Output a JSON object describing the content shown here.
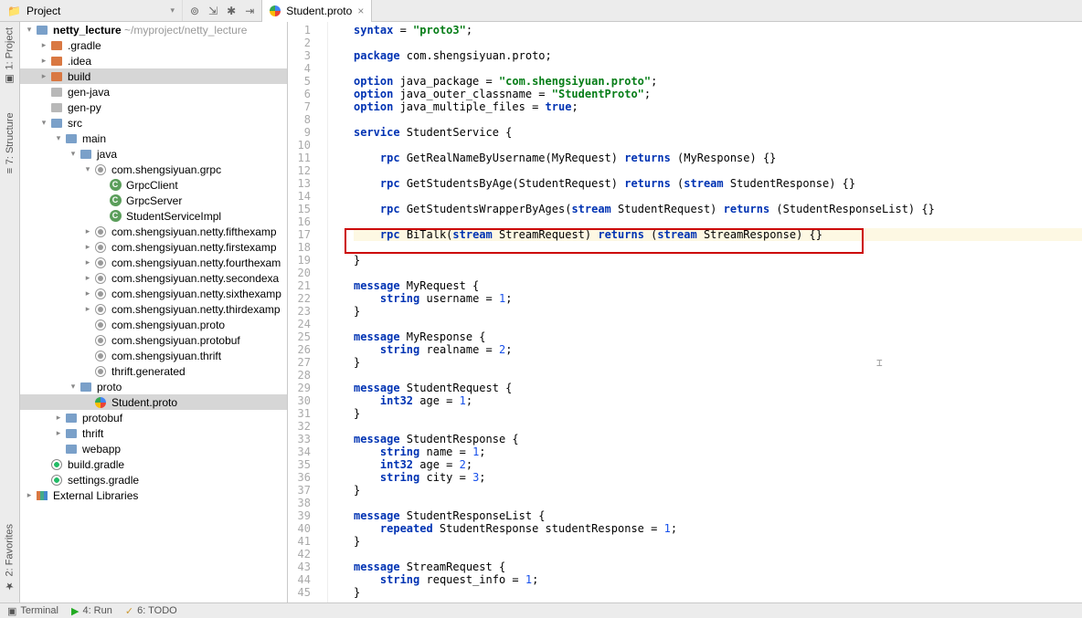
{
  "toolbar": {
    "project_label": "Project",
    "icons": [
      "target",
      "collapse",
      "settings",
      "hide"
    ]
  },
  "tab": {
    "filename": "Student.proto"
  },
  "tree": {
    "root": {
      "name": "netty_lecture",
      "path": "~/myproject/netty_lecture"
    },
    "items": [
      {
        "depth": 1,
        "arrow": "r",
        "icon": "folder-orange",
        "label": ".gradle"
      },
      {
        "depth": 1,
        "arrow": "r",
        "icon": "folder-orange",
        "label": ".idea"
      },
      {
        "depth": 1,
        "arrow": "r",
        "icon": "folder-orange",
        "label": "build",
        "sel": true
      },
      {
        "depth": 1,
        "arrow": "",
        "icon": "folder-gray",
        "label": "gen-java"
      },
      {
        "depth": 1,
        "arrow": "",
        "icon": "folder-gray",
        "label": "gen-py"
      },
      {
        "depth": 1,
        "arrow": "d",
        "icon": "folder-blue",
        "label": "src"
      },
      {
        "depth": 2,
        "arrow": "d",
        "icon": "folder-blue",
        "label": "main"
      },
      {
        "depth": 3,
        "arrow": "d",
        "icon": "folder-blue",
        "label": "java"
      },
      {
        "depth": 4,
        "arrow": "d",
        "icon": "pkg",
        "label": "com.shengsiyuan.grpc"
      },
      {
        "depth": 5,
        "arrow": "",
        "icon": "cls",
        "label": "GrpcClient"
      },
      {
        "depth": 5,
        "arrow": "",
        "icon": "cls",
        "label": "GrpcServer"
      },
      {
        "depth": 5,
        "arrow": "",
        "icon": "cls",
        "label": "StudentServiceImpl"
      },
      {
        "depth": 4,
        "arrow": "r",
        "icon": "pkg",
        "label": "com.shengsiyuan.netty.fifthexamp"
      },
      {
        "depth": 4,
        "arrow": "r",
        "icon": "pkg",
        "label": "com.shengsiyuan.netty.firstexamp"
      },
      {
        "depth": 4,
        "arrow": "r",
        "icon": "pkg",
        "label": "com.shengsiyuan.netty.fourthexam"
      },
      {
        "depth": 4,
        "arrow": "r",
        "icon": "pkg",
        "label": "com.shengsiyuan.netty.secondexa"
      },
      {
        "depth": 4,
        "arrow": "r",
        "icon": "pkg",
        "label": "com.shengsiyuan.netty.sixthexamp"
      },
      {
        "depth": 4,
        "arrow": "r",
        "icon": "pkg",
        "label": "com.shengsiyuan.netty.thirdexamp"
      },
      {
        "depth": 4,
        "arrow": "",
        "icon": "pkg",
        "label": "com.shengsiyuan.proto"
      },
      {
        "depth": 4,
        "arrow": "",
        "icon": "pkg",
        "label": "com.shengsiyuan.protobuf"
      },
      {
        "depth": 4,
        "arrow": "",
        "icon": "pkg",
        "label": "com.shengsiyuan.thrift"
      },
      {
        "depth": 4,
        "arrow": "",
        "icon": "pkg",
        "label": "thrift.generated"
      },
      {
        "depth": 3,
        "arrow": "d",
        "icon": "folder-blue",
        "label": "proto"
      },
      {
        "depth": 4,
        "arrow": "",
        "icon": "proto",
        "label": "Student.proto",
        "sel": true
      },
      {
        "depth": 2,
        "arrow": "r",
        "icon": "folder-blue",
        "label": "protobuf"
      },
      {
        "depth": 2,
        "arrow": "r",
        "icon": "folder-blue",
        "label": "thrift"
      },
      {
        "depth": 2,
        "arrow": "",
        "icon": "folder-blue",
        "label": "webapp"
      },
      {
        "depth": 1,
        "arrow": "",
        "icon": "gradle",
        "label": "build.gradle"
      },
      {
        "depth": 1,
        "arrow": "",
        "icon": "gradle",
        "label": "settings.gradle"
      }
    ],
    "external_libs": "External Libraries"
  },
  "code": {
    "lines": [
      [
        [
          "kw",
          "syntax"
        ],
        [
          "",
          ""
        ],
        [
          "",
          " = "
        ],
        [
          "str",
          "\"proto3\""
        ],
        [
          "",
          ";"
        ]
      ],
      [
        [
          "",
          ""
        ]
      ],
      [
        [
          "kw",
          "package"
        ],
        [
          "",
          " com.shengsiyuan.proto;"
        ]
      ],
      [
        [
          "",
          ""
        ]
      ],
      [
        [
          "kw",
          "option"
        ],
        [
          "",
          " java_package = "
        ],
        [
          "str",
          "\"com.shengsiyuan.proto\""
        ],
        [
          "",
          ";"
        ]
      ],
      [
        [
          "kw",
          "option"
        ],
        [
          "",
          " java_outer_classname = "
        ],
        [
          "str",
          "\"StudentProto\""
        ],
        [
          "",
          ";"
        ]
      ],
      [
        [
          "kw",
          "option"
        ],
        [
          "",
          " java_multiple_files = "
        ],
        [
          "kw",
          "true"
        ],
        [
          "",
          ";"
        ]
      ],
      [
        [
          "",
          ""
        ]
      ],
      [
        [
          "kw",
          "service"
        ],
        [
          "",
          " StudentService {"
        ]
      ],
      [
        [
          "",
          ""
        ]
      ],
      [
        [
          "",
          "    "
        ],
        [
          "kw",
          "rpc"
        ],
        [
          "",
          " GetRealNameByUsername(MyRequest) "
        ],
        [
          "kw",
          "returns"
        ],
        [
          "",
          " (MyResponse) {}"
        ]
      ],
      [
        [
          "",
          ""
        ]
      ],
      [
        [
          "",
          "    "
        ],
        [
          "kw",
          "rpc"
        ],
        [
          "",
          " GetStudentsByAge(StudentRequest) "
        ],
        [
          "kw",
          "returns"
        ],
        [
          "",
          " ("
        ],
        [
          "kw",
          "stream"
        ],
        [
          "",
          " StudentResponse) {}"
        ]
      ],
      [
        [
          "",
          ""
        ]
      ],
      [
        [
          "",
          "    "
        ],
        [
          "kw",
          "rpc"
        ],
        [
          "",
          " GetStudentsWrapperByAges("
        ],
        [
          "kw",
          "stream"
        ],
        [
          "",
          " StudentRequest) "
        ],
        [
          "kw",
          "returns"
        ],
        [
          "",
          " (StudentResponseList) {}"
        ]
      ],
      [
        [
          "",
          ""
        ]
      ],
      [
        [
          "",
          "    "
        ],
        [
          "kw",
          "rpc"
        ],
        [
          "",
          " BiTalk("
        ],
        [
          "kw",
          "stream"
        ],
        [
          "",
          " StreamRequest) "
        ],
        [
          "kw",
          "returns"
        ],
        [
          "",
          " ("
        ],
        [
          "kw",
          "stream"
        ],
        [
          "",
          " StreamResponse) {}"
        ]
      ],
      [
        [
          "",
          ""
        ]
      ],
      [
        [
          "",
          "}"
        ]
      ],
      [
        [
          "",
          ""
        ]
      ],
      [
        [
          "kw",
          "message"
        ],
        [
          "",
          " MyRequest {"
        ]
      ],
      [
        [
          "",
          "    "
        ],
        [
          "kw",
          "string"
        ],
        [
          "",
          " username = "
        ],
        [
          "num",
          "1"
        ],
        [
          "",
          ";"
        ]
      ],
      [
        [
          "",
          "}"
        ]
      ],
      [
        [
          "",
          ""
        ]
      ],
      [
        [
          "kw",
          "message"
        ],
        [
          "",
          " MyResponse {"
        ]
      ],
      [
        [
          "",
          "    "
        ],
        [
          "kw",
          "string"
        ],
        [
          "",
          " realname = "
        ],
        [
          "num",
          "2"
        ],
        [
          "",
          ";"
        ]
      ],
      [
        [
          "",
          "}"
        ]
      ],
      [
        [
          "",
          ""
        ]
      ],
      [
        [
          "kw",
          "message"
        ],
        [
          "",
          " StudentRequest {"
        ]
      ],
      [
        [
          "",
          "    "
        ],
        [
          "kw",
          "int32"
        ],
        [
          "",
          " age = "
        ],
        [
          "num",
          "1"
        ],
        [
          "",
          ";"
        ]
      ],
      [
        [
          "",
          "}"
        ]
      ],
      [
        [
          "",
          ""
        ]
      ],
      [
        [
          "kw",
          "message"
        ],
        [
          "",
          " StudentResponse {"
        ]
      ],
      [
        [
          "",
          "    "
        ],
        [
          "kw",
          "string"
        ],
        [
          "",
          " name = "
        ],
        [
          "num",
          "1"
        ],
        [
          "",
          ";"
        ]
      ],
      [
        [
          "",
          "    "
        ],
        [
          "kw",
          "int32"
        ],
        [
          "",
          " age = "
        ],
        [
          "num",
          "2"
        ],
        [
          "",
          ";"
        ]
      ],
      [
        [
          "",
          "    "
        ],
        [
          "kw",
          "string"
        ],
        [
          "",
          " city = "
        ],
        [
          "num",
          "3"
        ],
        [
          "",
          ";"
        ]
      ],
      [
        [
          "",
          "}"
        ]
      ],
      [
        [
          "",
          ""
        ]
      ],
      [
        [
          "kw",
          "message"
        ],
        [
          "",
          " StudentResponseList {"
        ]
      ],
      [
        [
          "",
          "    "
        ],
        [
          "kw",
          "repeated"
        ],
        [
          "",
          " StudentResponse studentResponse = "
        ],
        [
          "num",
          "1"
        ],
        [
          "",
          ";"
        ]
      ],
      [
        [
          "",
          "}"
        ]
      ],
      [
        [
          "",
          ""
        ]
      ],
      [
        [
          "kw",
          "message"
        ],
        [
          "",
          " StreamRequest {"
        ]
      ],
      [
        [
          "",
          "    "
        ],
        [
          "kw",
          "string"
        ],
        [
          "",
          " request_info = "
        ],
        [
          "num",
          "1"
        ],
        [
          "",
          ";"
        ]
      ],
      [
        [
          "",
          "}"
        ]
      ]
    ]
  },
  "left_tools": {
    "project": "1: Project",
    "structure": "7: Structure",
    "favorites": "2: Favorites"
  },
  "bottom": {
    "terminal": "Terminal",
    "run": "4: Run",
    "todo": "6: TODO"
  }
}
